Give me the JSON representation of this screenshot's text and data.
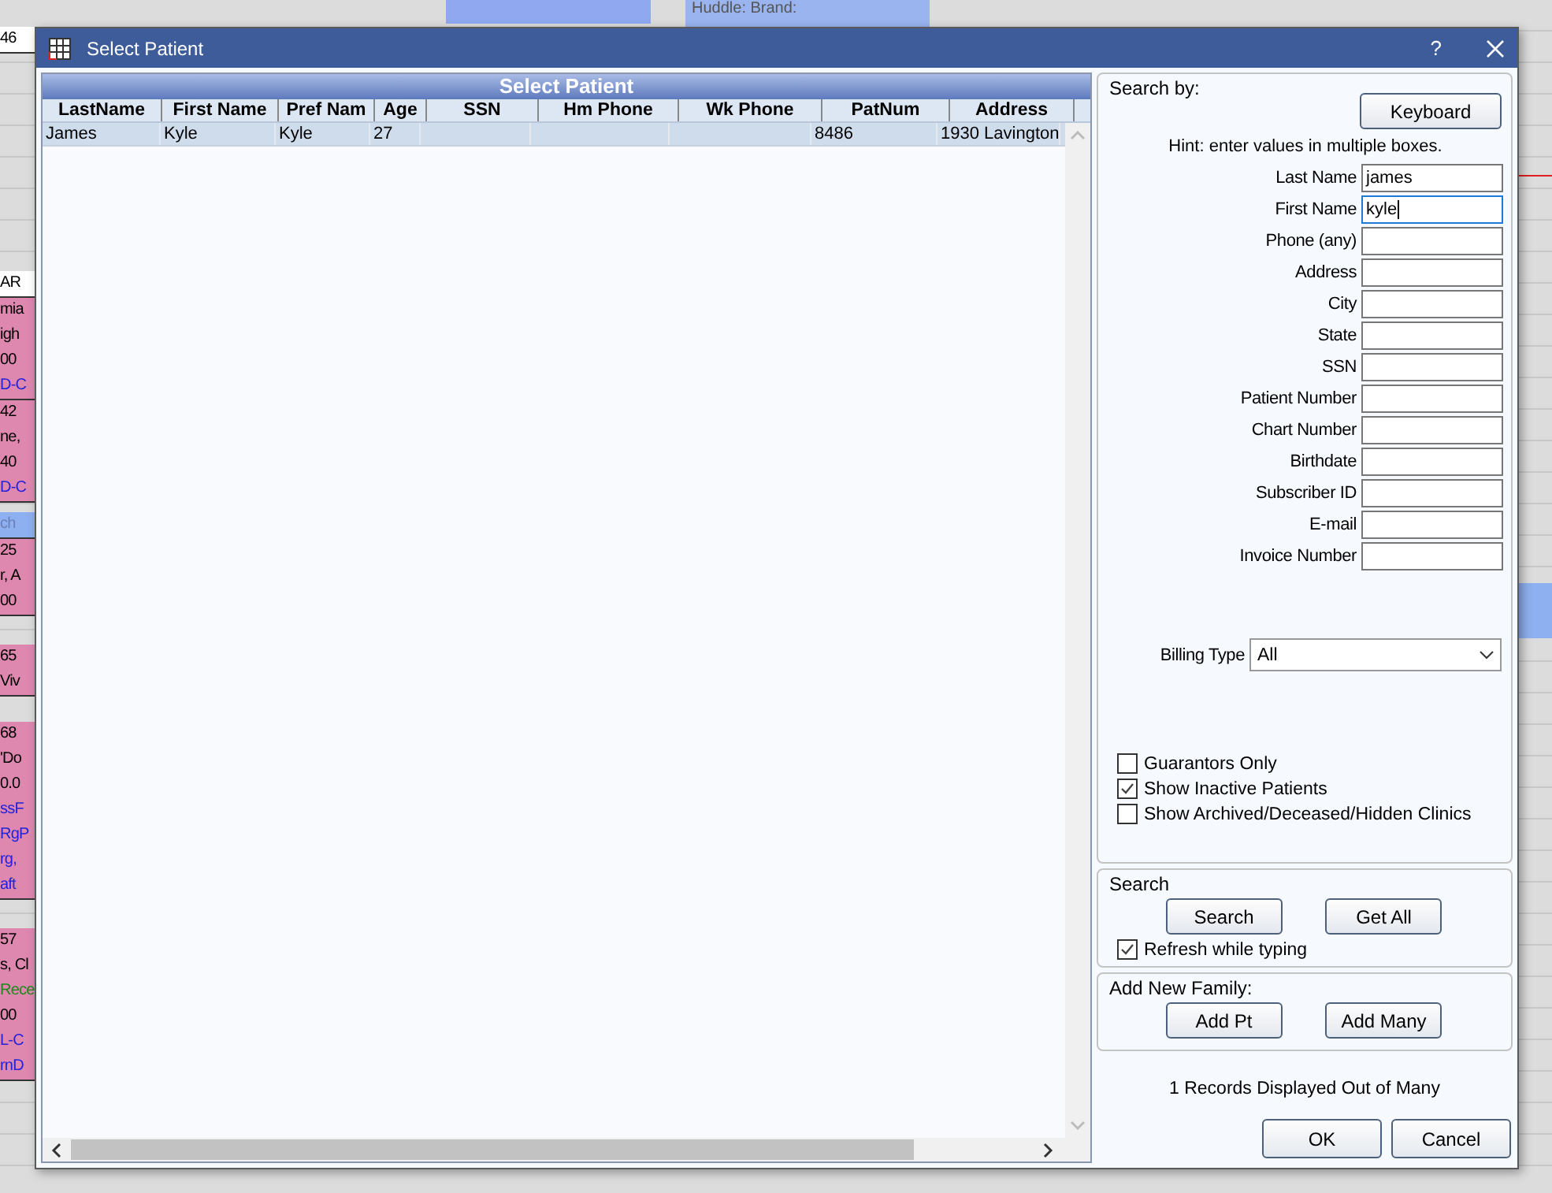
{
  "background": {
    "top_label": "Huddle: Brand:",
    "blocks": [
      {
        "kind": "white",
        "lines": [
          {
            "text": "46",
            "kind": "plain"
          }
        ]
      },
      {
        "kind": "white",
        "lines": [
          {
            "text": "AR",
            "kind": "plain"
          }
        ]
      },
      {
        "kind": "pink",
        "lines": [
          {
            "text": "mia",
            "kind": "plain"
          },
          {
            "text": "igh",
            "kind": "plain"
          },
          {
            "text": "00",
            "kind": "plain"
          },
          {
            "text": "D-C",
            "kind": "link"
          }
        ]
      },
      {
        "kind": "pink",
        "lines": [
          {
            "text": "42",
            "kind": "plain"
          },
          {
            "text": "ne,",
            "kind": "plain"
          },
          {
            "text": "40",
            "kind": "plain"
          },
          {
            "text": "D-C",
            "kind": "link"
          }
        ]
      },
      {
        "kind": "band",
        "lines": [
          {
            "text": "ch",
            "kind": "faint"
          }
        ]
      },
      {
        "kind": "pink",
        "lines": [
          {
            "text": "25",
            "kind": "plain"
          },
          {
            "text": "r, A",
            "kind": "plain"
          },
          {
            "text": "00",
            "kind": "plain"
          }
        ]
      },
      {
        "kind": "pink",
        "lines": [
          {
            "text": "65",
            "kind": "plain"
          },
          {
            "text": "Viv",
            "kind": "plain"
          }
        ]
      },
      {
        "kind": "pink",
        "lines": [
          {
            "text": "68",
            "kind": "plain"
          },
          {
            "text": "'Do",
            "kind": "plain"
          },
          {
            "text": "0.0",
            "kind": "plain"
          },
          {
            "text": "ssF",
            "kind": "link"
          },
          {
            "text": "RgP",
            "kind": "link"
          },
          {
            "text": "rg,",
            "kind": "link"
          },
          {
            "text": "aft",
            "kind": "link"
          }
        ]
      },
      {
        "kind": "pink",
        "lines": [
          {
            "text": "57",
            "kind": "plain"
          },
          {
            "text": "s, Cl",
            "kind": "plain"
          },
          {
            "text": "Rece",
            "kind": "note"
          },
          {
            "text": "00",
            "kind": "plain"
          },
          {
            "text": "L-C",
            "kind": "link"
          },
          {
            "text": "rnD",
            "kind": "link"
          }
        ]
      }
    ]
  },
  "window": {
    "title": "Select Patient",
    "help": "?"
  },
  "grid": {
    "title": "Select Patient",
    "columns": [
      "LastName",
      "First Name",
      "Pref Nam",
      "Age",
      "SSN",
      "Hm Phone",
      "Wk Phone",
      "PatNum",
      "Address"
    ],
    "rows": [
      {
        "selected": true,
        "cells": [
          "James",
          "Kyle",
          "Kyle",
          "27",
          null,
          null,
          null,
          "8486",
          "1930 Lavington"
        ]
      }
    ]
  },
  "search_by": {
    "heading": "Search by:",
    "keyboard_button": "Keyboard",
    "hint": "Hint: enter values in multiple boxes.",
    "fields": [
      {
        "label": "Last Name",
        "value": "james",
        "focused": false
      },
      {
        "label": "First Name",
        "value": "kyle",
        "focused": true
      },
      {
        "label": "Phone (any)",
        "focused": false
      },
      {
        "label": "Address",
        "focused": false
      },
      {
        "label": "City",
        "focused": false
      },
      {
        "label": "State",
        "focused": false
      },
      {
        "label": "SSN",
        "focused": false
      },
      {
        "label": "Patient Number",
        "focused": false
      },
      {
        "label": "Chart Number",
        "focused": false
      },
      {
        "label": "Birthdate",
        "focused": false
      },
      {
        "label": "Subscriber ID",
        "focused": false
      },
      {
        "label": "E-mail",
        "focused": false
      },
      {
        "label": "Invoice Number",
        "focused": false
      }
    ],
    "billing_type": {
      "label": "Billing Type",
      "value": "All"
    },
    "checkboxes": [
      {
        "label": "Guarantors Only",
        "checked": false
      },
      {
        "label": "Show Inactive Patients",
        "checked": true
      },
      {
        "label": "Show Archived/Deceased/Hidden Clinics",
        "checked": false
      }
    ]
  },
  "search": {
    "heading": "Search",
    "buttons": [
      "Search",
      "Get All"
    ],
    "refresh": {
      "label": "Refresh while typing",
      "checked": true
    }
  },
  "add_family": {
    "heading": "Add New Family:",
    "buttons": [
      "Add Pt",
      "Add Many"
    ]
  },
  "status": "1 Records Displayed Out of Many",
  "buttons": [
    "OK",
    "Cancel"
  ]
}
